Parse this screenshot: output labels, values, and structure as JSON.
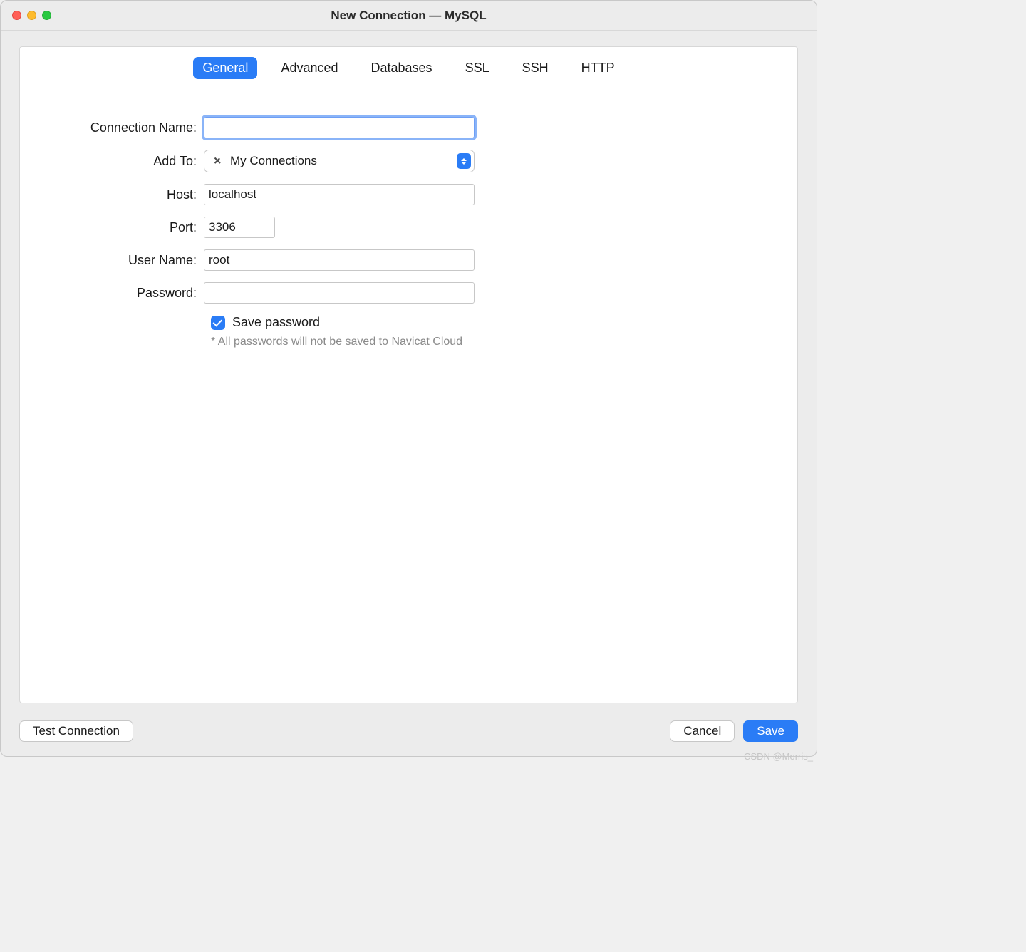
{
  "window": {
    "title": "New Connection — MySQL"
  },
  "tabs": {
    "general": "General",
    "advanced": "Advanced",
    "databases": "Databases",
    "ssl": "SSL",
    "ssh": "SSH",
    "http": "HTTP"
  },
  "labels": {
    "connection_name": "Connection Name:",
    "add_to": "Add To:",
    "host": "Host:",
    "port": "Port:",
    "user_name": "User Name:",
    "password": "Password:"
  },
  "fields": {
    "connection_name": "",
    "add_to_selected": "My Connections",
    "host": "localhost",
    "port": "3306",
    "user_name": "root",
    "password": ""
  },
  "save_password": {
    "checked": true,
    "label": "Save password",
    "hint": "* All passwords will not be saved to Navicat Cloud"
  },
  "buttons": {
    "test": "Test Connection",
    "cancel": "Cancel",
    "save": "Save"
  },
  "watermark": "CSDN @Morris_"
}
